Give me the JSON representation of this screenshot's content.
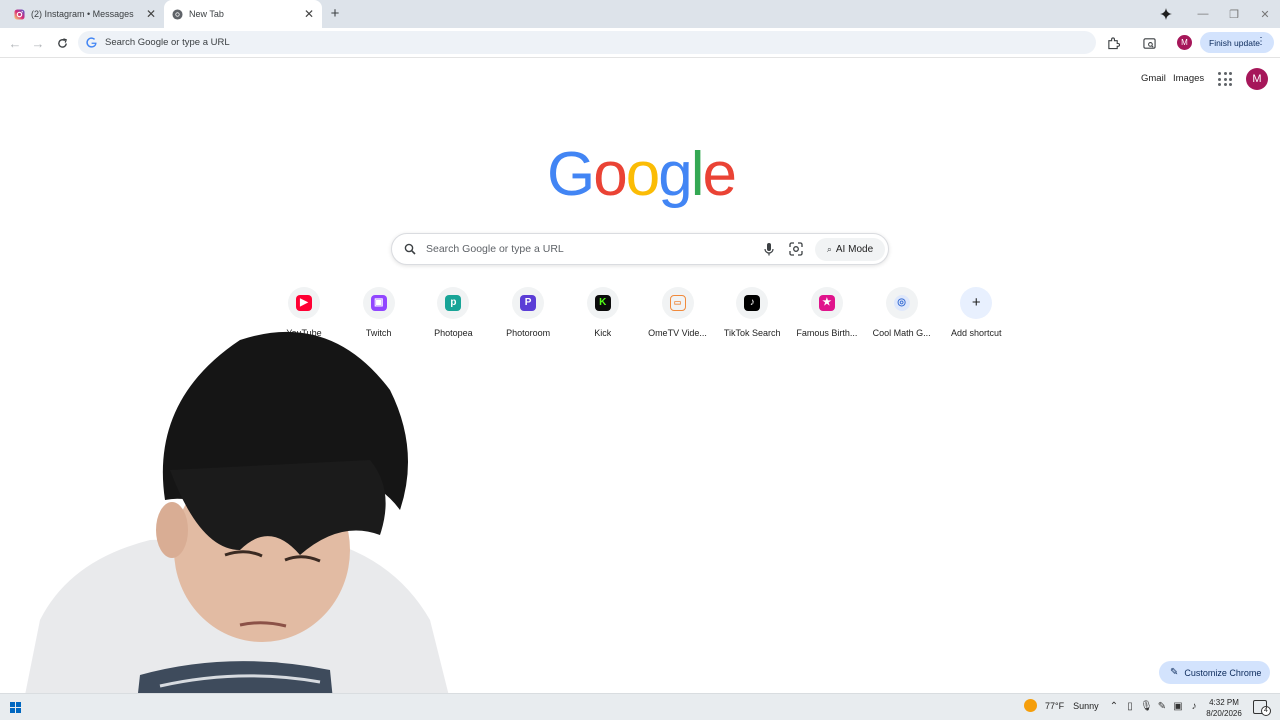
{
  "tabs": [
    {
      "title": "(2) Instagram • Messages",
      "favicon": "instagram-icon",
      "active": false
    },
    {
      "title": "New Tab",
      "favicon": "chrome-icon",
      "active": true
    }
  ],
  "toolbar": {
    "omnibox_placeholder": "Search Google or type a URL",
    "profile_initial": "M",
    "finish_update_label": "Finish update"
  },
  "top_links": {
    "gmail": "Gmail",
    "images": "Images",
    "avatar_initial": "M"
  },
  "logo": {
    "letters": [
      "G",
      "o",
      "o",
      "g",
      "l",
      "e"
    ],
    "colors": [
      "#4285f4",
      "#ea4335",
      "#fbbc05",
      "#4285f4",
      "#34a853",
      "#ea4335"
    ]
  },
  "search": {
    "placeholder": "Search Google or type a URL",
    "ai_mode_label": "AI Mode"
  },
  "shortcuts": [
    {
      "label": "YouTube",
      "icon": "youtube-icon",
      "color": "#ff0033"
    },
    {
      "label": "Twitch",
      "icon": "twitch-icon",
      "color": "#9146ff"
    },
    {
      "label": "Photopea",
      "icon": "photopea-icon",
      "color": "#18a497"
    },
    {
      "label": "Photoroom",
      "icon": "photoroom-icon",
      "color": "#5b3dd6"
    },
    {
      "label": "Kick",
      "icon": "kick-icon",
      "color": "#53fc18"
    },
    {
      "label": "OmeTV Vide...",
      "icon": "ometv-icon",
      "color": "#f08a3c"
    },
    {
      "label": "TikTok Search",
      "icon": "tiktok-icon",
      "color": "#000000"
    },
    {
      "label": "Famous Birth...",
      "icon": "famous-birthdays-icon",
      "color": "#e0148c"
    },
    {
      "label": "Cool Math G...",
      "icon": "coolmath-icon",
      "color": "#3b6fd4"
    },
    {
      "label": "Add shortcut",
      "icon": "plus-icon",
      "color": "#1f1f1f"
    }
  ],
  "customize_label": "Customize Chrome",
  "taskbar": {
    "temperature": "77°F",
    "condition": "Sunny",
    "time": "4:32 PM",
    "date": "8/20/2026",
    "notification_count": "4"
  }
}
